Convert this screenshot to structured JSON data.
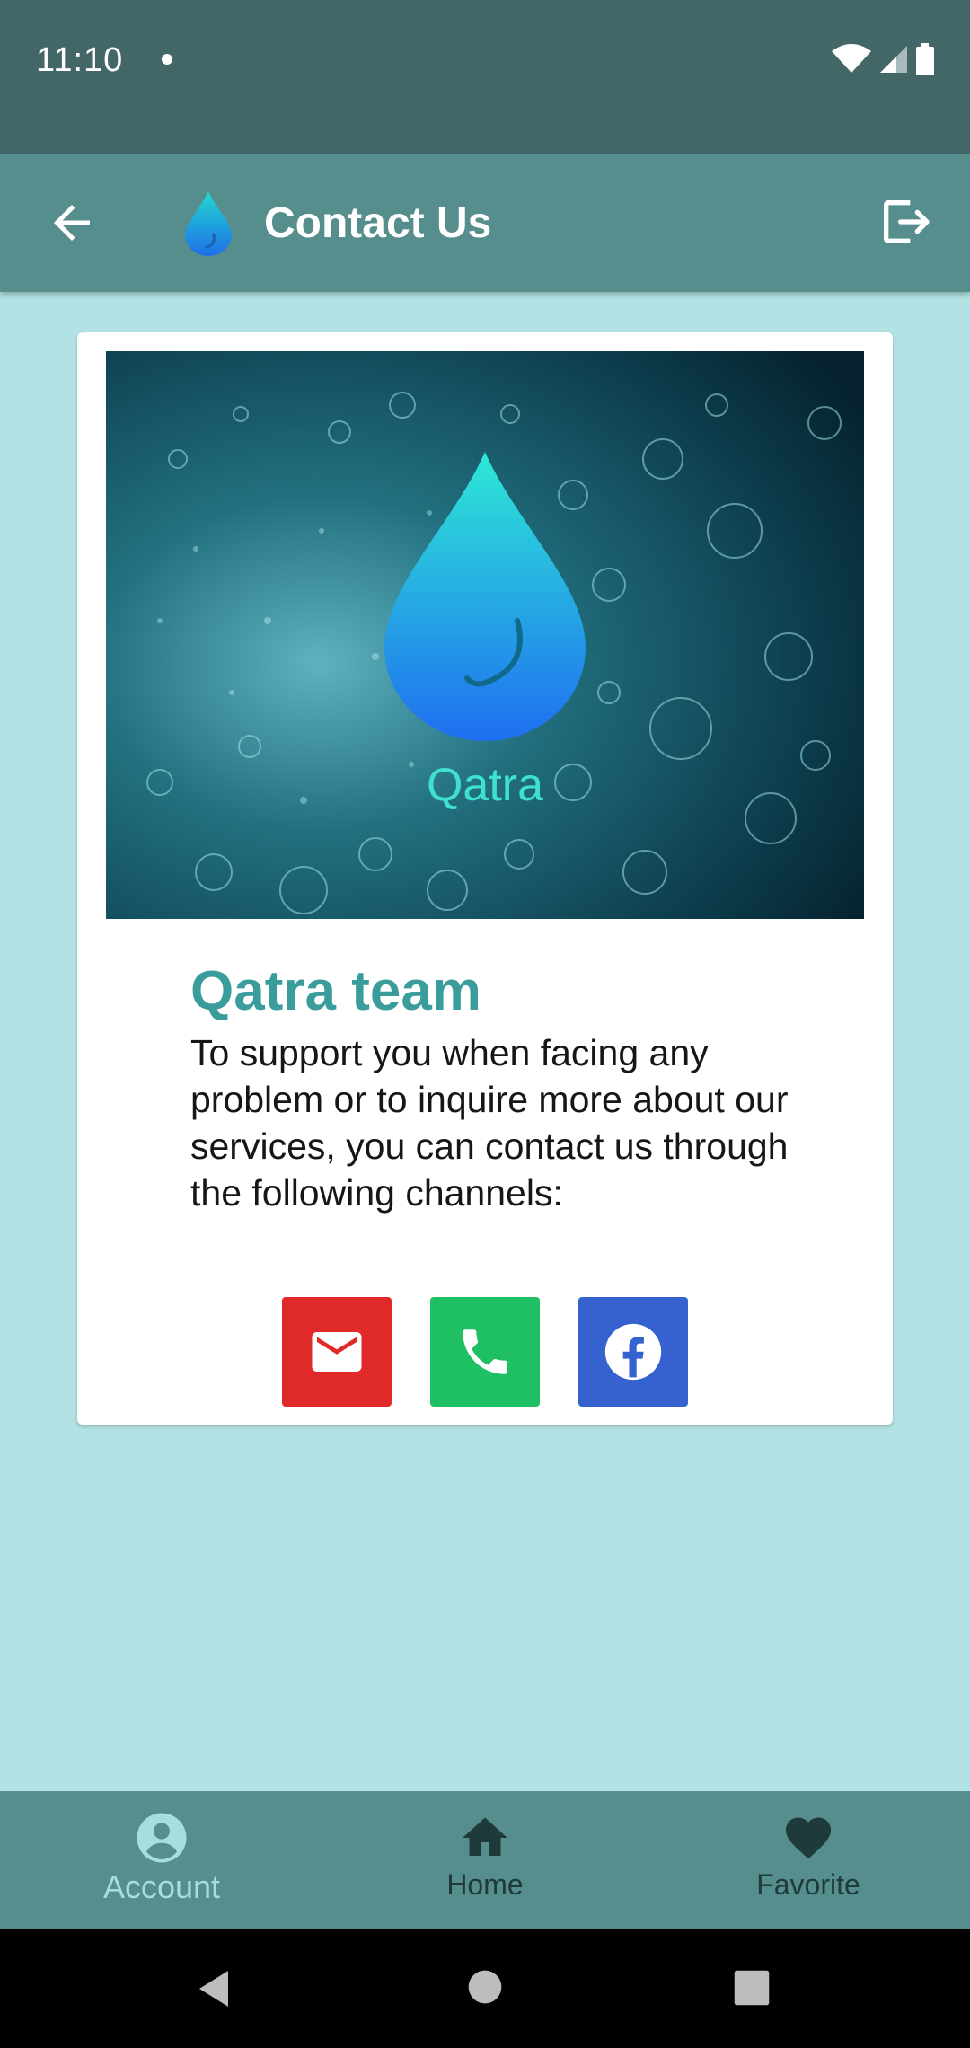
{
  "status_bar": {
    "time": "11:10"
  },
  "app_bar": {
    "title": "Contact Us"
  },
  "hero": {
    "logo_text": "Qatra"
  },
  "card": {
    "title": "Qatra team",
    "body": "To support you when facing any problem or to inquire more about our services, you can contact us through the following channels:"
  },
  "channels": [
    {
      "name": "email",
      "icon": "email-icon",
      "color": "#e02a2a"
    },
    {
      "name": "phone",
      "icon": "phone-icon",
      "color": "#1fc063"
    },
    {
      "name": "facebook",
      "icon": "facebook-icon",
      "color": "#3562cf"
    }
  ],
  "bottom_nav": {
    "items": [
      {
        "label": "Account",
        "icon": "account-circle-icon",
        "active": true
      },
      {
        "label": "Home",
        "icon": "home-icon",
        "active": false
      },
      {
        "label": "Favorite",
        "icon": "heart-icon",
        "active": false
      }
    ]
  },
  "colors": {
    "background": "#b2e2e3",
    "app_bar": "#568d8d",
    "status_bar": "#436667",
    "accent_title": "#3a9d9b"
  }
}
